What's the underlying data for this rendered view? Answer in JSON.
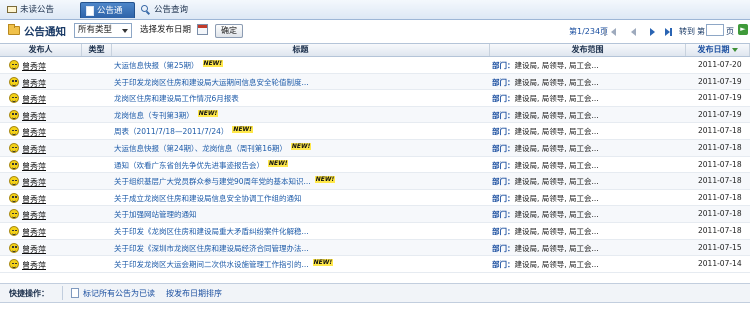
{
  "tabs": [
    {
      "label": "未读公告",
      "icon": "envelope-icon"
    },
    {
      "label": "公告通知",
      "icon": "document-icon",
      "active": true
    },
    {
      "label": "公告查询",
      "icon": "search-icon"
    }
  ],
  "toolbar": {
    "title": "公告通知",
    "type_select": "所有类型",
    "date_label": "选择发布日期",
    "confirm": "确定"
  },
  "pager": {
    "info": "第1/234页",
    "goto": "转到",
    "di": "第",
    "ye": "页"
  },
  "columns": {
    "publisher": "发布人",
    "type": "类型",
    "title": "标题",
    "scope": "发布范围",
    "date": "发布日期"
  },
  "rows": [
    {
      "publisher": "曾秀萍",
      "title": "大运信息快报（第25期）",
      "new": true,
      "scope_label": "部门：",
      "scope": "建设局, 局领导, 局工会...",
      "date": "2011-07-20"
    },
    {
      "publisher": "曾秀萍",
      "title": "关于印发龙岗区住房和建设局大运期间信息安全轮值制度...",
      "new": false,
      "scope_label": "部门：",
      "scope": "建设局, 局领导, 局工会...",
      "date": "2011-07-19"
    },
    {
      "publisher": "曾秀萍",
      "title": "龙岗区住房和建设局工作情况6月报表",
      "new": false,
      "scope_label": "部门：",
      "scope": "建设局, 局领导, 局工会...",
      "date": "2011-07-19"
    },
    {
      "publisher": "曾秀萍",
      "title": "龙岗信息（专刊第3期）",
      "new": true,
      "scope_label": "部门：",
      "scope": "建设局, 局领导, 局工会...",
      "date": "2011-07-19"
    },
    {
      "publisher": "曾秀萍",
      "title": "周表（2011/7/18—2011/7/24）",
      "new": true,
      "scope_label": "部门：",
      "scope": "建设局, 局领导, 局工会...",
      "date": "2011-07-18"
    },
    {
      "publisher": "曾秀萍",
      "title": "大运信息快报（第24期）、龙岗信息（周刊第16期）",
      "new": true,
      "scope_label": "部门：",
      "scope": "建设局, 局领导, 局工会...",
      "date": "2011-07-18"
    },
    {
      "publisher": "曾秀萍",
      "title": "通知（欢看广东省创先争优先进事迹报告会）",
      "new": true,
      "scope_label": "部门：",
      "scope": "建设局, 局领导, 局工会...",
      "date": "2011-07-18"
    },
    {
      "publisher": "曾秀萍",
      "title": "关于组织基层广大党员群众参与建党90周年党的基本知识...",
      "new": true,
      "scope_label": "部门：",
      "scope": "建设局, 局领导, 局工会...",
      "date": "2011-07-18"
    },
    {
      "publisher": "曾秀萍",
      "title": "关于成立龙岗区住房和建设局信息安全协调工作组的通知",
      "new": false,
      "scope_label": "部门：",
      "scope": "建设局, 局领导, 局工会...",
      "date": "2011-07-18"
    },
    {
      "publisher": "曾秀萍",
      "title": "关于加强网站管理的通知",
      "new": false,
      "scope_label": "部门：",
      "scope": "建设局, 局领导, 局工会...",
      "date": "2011-07-18"
    },
    {
      "publisher": "曾秀萍",
      "title": "关于印发《龙岗区住房和建设局重大矛盾纠纷案件化解稳...",
      "new": false,
      "scope_label": "部门：",
      "scope": "建设局, 局领导, 局工会...",
      "date": "2011-07-18"
    },
    {
      "publisher": "曾秀萍",
      "title": "关于印发《深圳市龙岗区住房和建设局经济合同管理办法...",
      "new": false,
      "scope_label": "部门：",
      "scope": "建设局, 局领导, 局工会...",
      "date": "2011-07-15"
    },
    {
      "publisher": "曾秀萍",
      "title": "关于印发龙岗区大运会期间二次供水设施管理工作指引的...",
      "new": true,
      "scope_label": "部门：",
      "scope": "建设局, 局领导, 局工会...",
      "date": "2011-07-14"
    }
  ],
  "new_badge": "NEW!",
  "quickbar": {
    "label": "快捷操作：",
    "mark_read": "标记所有公告为已读",
    "sort_by_date": "按发布日期排序"
  }
}
